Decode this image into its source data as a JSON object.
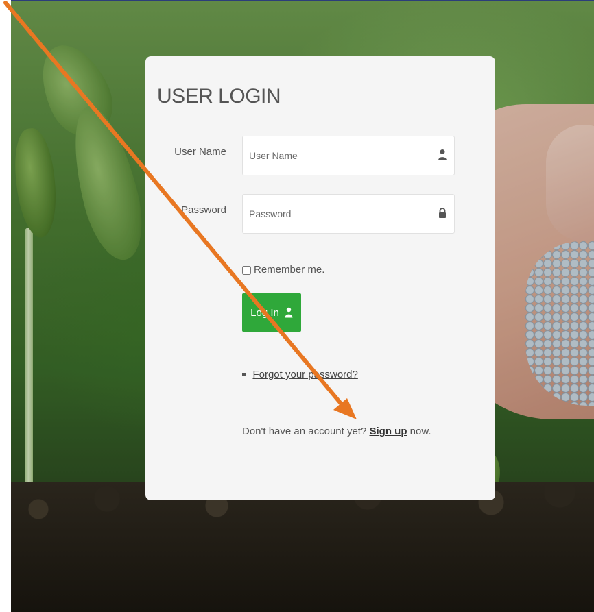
{
  "login": {
    "title": "USER LOGIN",
    "username_label": "User Name",
    "username_placeholder": "User Name",
    "password_label": "Password",
    "password_placeholder": "Password",
    "remember_label": "Remember me.",
    "login_button_label": "Log In",
    "forgot_link": "Forgot your password?",
    "signup_prefix": "Don't have an account yet?",
    "signup_link": "Sign up",
    "signup_suffix": "now."
  },
  "icons": {
    "username": "user-icon",
    "password": "lock-icon",
    "login_button": "user-icon",
    "annotation": "arrow-icon"
  },
  "colors": {
    "button_green": "#2fa83a",
    "card_background": "#f5f5f5",
    "annotation_arrow": "#e87722"
  }
}
